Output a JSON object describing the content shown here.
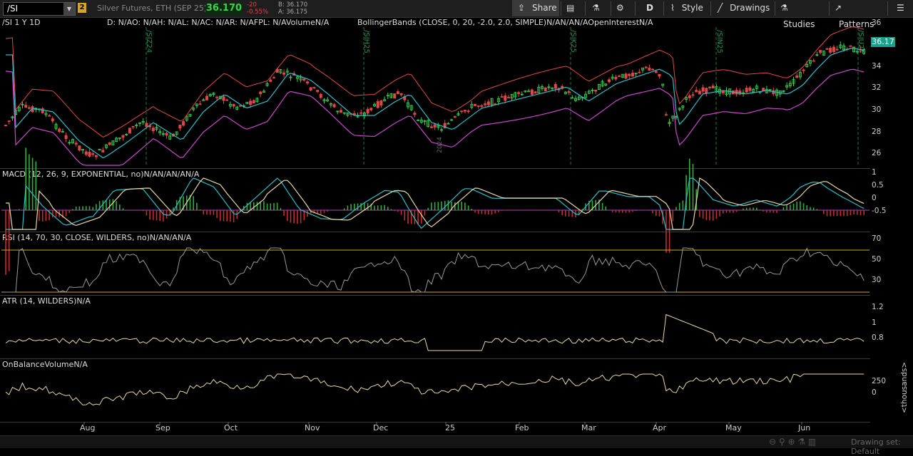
{
  "toolbar": {
    "symbol": "/SI",
    "link_badge": "2",
    "instrument": "Silver Futures, ETH (SEP 25)",
    "last": "36.170",
    "change": "-20",
    "change_pct": "-0.55%",
    "bid": "B: 36.170",
    "ask": "A: 36.175",
    "share": "Share",
    "period": "D",
    "style": "Style",
    "drawings": "Drawings",
    "studies": "Studies",
    "patterns": "Patterns"
  },
  "price_pane": {
    "title": "/SI 1 Y 1D",
    "info": "D: N/AO: N/AH: N/AL: N/AC: N/AR: N/AFPL: N/AVolumeN/A",
    "bbands": "BollingerBands (CLOSE, 0, 20, -2.0, 2.0, SIMPLE)N/AN/AN/AOpenInterestN/A",
    "ticks": [
      "36",
      "34",
      "32",
      "30",
      "28",
      "26"
    ],
    "last_price": "36.17",
    "expiry_labels": [
      "/SIZ24",
      "/SIH25",
      "/SIK25",
      "/SIN25",
      "/SIU25"
    ],
    "year_marker": "2024",
    "colors": {
      "up": "#3fcf52",
      "down": "#e04848",
      "mid": "#2bbfc8",
      "upper": "#e04848",
      "lower": "#c849c8"
    }
  },
  "macd_pane": {
    "title": "MACD (12, 26, 9, EXPONENTIAL, no)N/AN/AN/AN/A",
    "ticks": [
      "1",
      "0.5",
      "0",
      "-0.5"
    ]
  },
  "rsi_pane": {
    "title": "RSI (14, 70, 30, CLOSE, WILDERS, no)N/AN/AN/A",
    "ticks": [
      "70",
      "50",
      "30"
    ]
  },
  "atr_pane": {
    "title": "ATR (14, WILDERS)N/A",
    "ticks": [
      "1.2",
      "1",
      "0.8"
    ]
  },
  "obv_pane": {
    "title": "OnBalanceVolumeN/A",
    "ticks": [
      "250",
      "0"
    ],
    "unit": "<thousands>"
  },
  "x_axis": [
    "Aug",
    "Sep",
    "Oct",
    "Nov",
    "Dec",
    "25",
    "Feb",
    "Mar",
    "Apr",
    "May",
    "Jun"
  ],
  "status": {
    "drawing_set": "Drawing set: Default"
  }
}
